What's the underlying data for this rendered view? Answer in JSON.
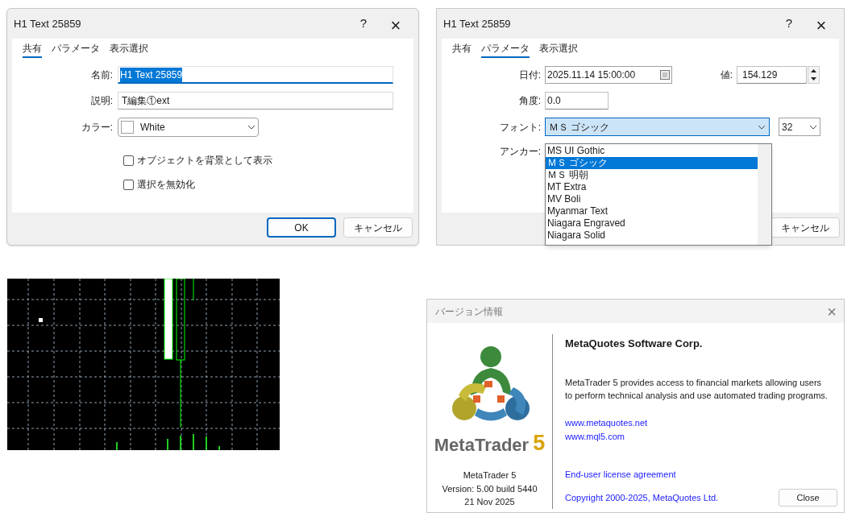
{
  "common_dialog": {
    "title": "H1 Text 25859",
    "help": "?",
    "close": "×",
    "tabs": [
      {
        "label": "共有",
        "selected": true
      },
      {
        "label": "パラメータ",
        "selected": false
      },
      {
        "label": "表示選択",
        "selected": false
      }
    ],
    "name": {
      "label": "名前:",
      "value": "H1 Text 25859",
      "selected_text": true
    },
    "description": {
      "label": "説明:",
      "value": "T編集①ext"
    },
    "color": {
      "label": "カラー:",
      "value": "White"
    },
    "checkboxes": [
      {
        "label": "オブジェクトを背景として表示",
        "checked": false
      },
      {
        "label": "選択を無効化",
        "checked": false
      }
    ],
    "buttons": [
      {
        "label": "OK",
        "default": true
      },
      {
        "label": "キャンセル",
        "default": false
      }
    ]
  },
  "parameters_dialog": {
    "title": "H1 Text 25859",
    "help": "?",
    "close": "×",
    "tabs": [
      {
        "label": "共有",
        "selected": false
      },
      {
        "label": "パラメータ",
        "selected": true
      },
      {
        "label": "表示選択",
        "selected": false
      }
    ],
    "date": {
      "label": "日付:",
      "value": "2025.11.14 15:00:00"
    },
    "price": {
      "label": "値:",
      "value": "154.129"
    },
    "angle": {
      "label": "角度:",
      "value": "0.0"
    },
    "font": {
      "label": "フォント:",
      "value": "ＭＳ ゴシック",
      "size": "32"
    },
    "anchor": {
      "label": "アンカー:"
    },
    "font_list": [
      {
        "label": "MS UI Gothic",
        "selected": false
      },
      {
        "label": "ＭＳ ゴシック",
        "selected": true
      },
      {
        "label": "ＭＳ 明朝",
        "selected": false
      },
      {
        "label": "MT Extra",
        "selected": false
      },
      {
        "label": "MV Boli",
        "selected": false
      },
      {
        "label": "Myanmar Text",
        "selected": false
      },
      {
        "label": "Niagara Engraved",
        "selected": false
      },
      {
        "label": "Niagara Solid",
        "selected": false
      }
    ],
    "buttons": [
      {
        "label": "キャンセル",
        "default": false
      }
    ]
  },
  "about_dialog": {
    "title": "バージョン情報",
    "close": "×",
    "logo": {
      "word": "MetaTrader",
      "number": "5"
    },
    "product": "MetaTrader 5",
    "version": "Version: 5.00 build 5440",
    "date": "21 Nov 2025",
    "company": "MetaQuotes Software Corp.",
    "description": "MetaTrader 5 provides access to financial markets allowing users to perform technical analysis and use automated trading programs.",
    "links": [
      "www.metaquotes.net",
      "www.mql5.com"
    ],
    "license": "End-user license agreement",
    "copyright": "Copyright 2000-2025, MetaQuotes Ltd.",
    "button": "Close"
  }
}
